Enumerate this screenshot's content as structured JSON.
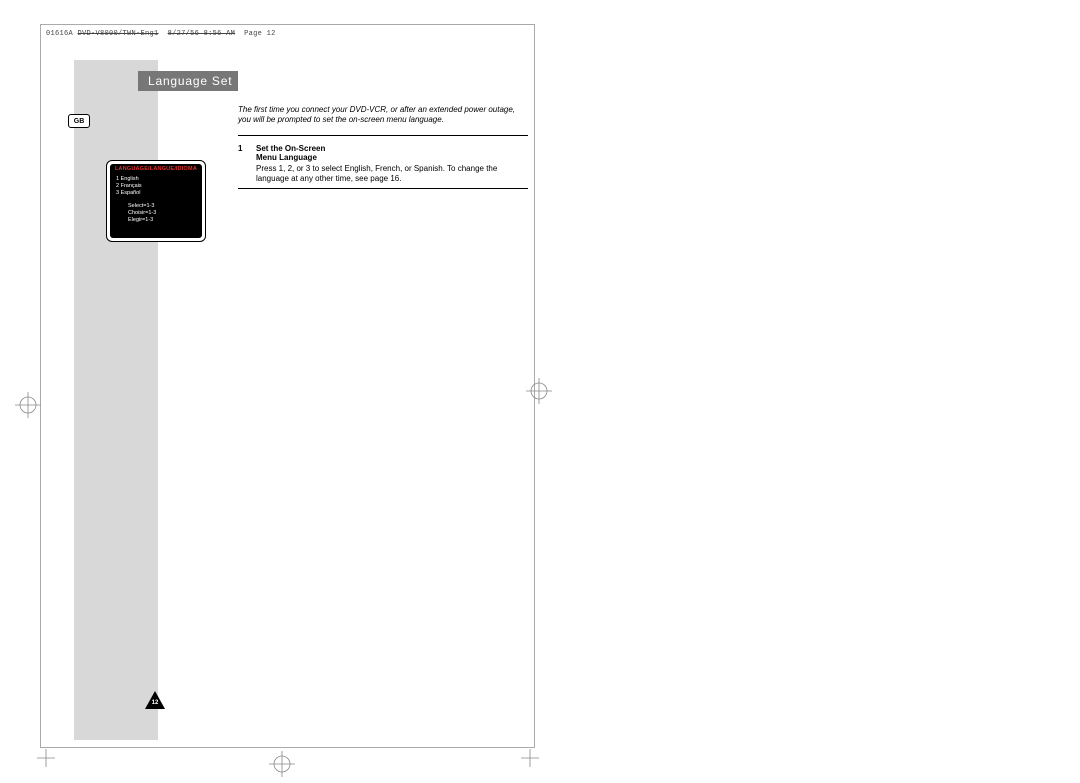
{
  "header": {
    "file_code": "01616A",
    "file_name": "DVD-V8000/TWN-Eng1",
    "timestamp": "8/27/56 8:56 AM",
    "page_label": "Page 12"
  },
  "region_badge": "GB",
  "title": "Language Set",
  "intro": "The first time you connect your DVD-VCR, or after an extended power outage, you will be prompted to set the on-screen menu language.",
  "step": {
    "number": "1",
    "title_line1": "Set the On-Screen",
    "title_line2": "Menu Language",
    "body": "Press 1, 2, or 3 to select English, French, or Spanish. To change the language at any other time, see page 16."
  },
  "screen": {
    "title": "LANGUAGE/LANGUE/IDIOMA",
    "options": [
      "1 English",
      "2 Français",
      "3 Español"
    ],
    "hints": [
      "Select=1-3",
      "Choisir=1-3",
      "Elegir=1-3"
    ]
  },
  "page_number": "12"
}
